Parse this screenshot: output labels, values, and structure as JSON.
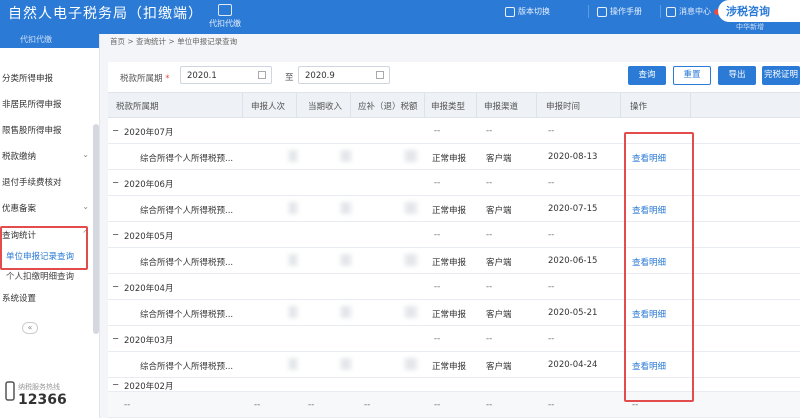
{
  "header": {
    "title": "自然人电子税务局（扣缴端）",
    "center_label": "代扣代缴",
    "links": [
      "版本切换",
      "操作手册",
      "消息中心"
    ],
    "user": "涉税咨询",
    "user_sub": "中华新增"
  },
  "sidebar": {
    "top_label": "代扣代缴",
    "items": [
      {
        "label": "分类所得申报",
        "chevron": ""
      },
      {
        "label": "非居民所得申报",
        "chevron": ""
      },
      {
        "label": "限售股所得申报",
        "chevron": ""
      },
      {
        "label": "税款缴纳",
        "chevron": "⌄"
      },
      {
        "label": "退付手续费核对",
        "chevron": ""
      },
      {
        "label": "优惠备案",
        "chevron": "⌄"
      },
      {
        "label": "查询统计",
        "chevron": "^"
      }
    ],
    "subitems": [
      "单位申报记录查询",
      "个人扣缴明细查询"
    ],
    "settings": "系统设置",
    "collapse_icon": "«",
    "hotline_label": "纳税服务热线",
    "hotline_number": "12366"
  },
  "breadcrumb": "首页 > 查询统计 > 单位申报记录查询",
  "filter": {
    "label": "税款所属期",
    "required_mark": "*",
    "from_value": "2020.1",
    "to_label": "至",
    "to_value": "2020.9"
  },
  "buttons": {
    "query": "查询",
    "reset": "重置",
    "export": "导出",
    "tax_proof": "完税证明"
  },
  "table": {
    "headers": [
      "税款所属期",
      "申报人次",
      "当期收入",
      "应补（退）税额",
      "申报类型",
      "申报渠道",
      "申报时间",
      "操作"
    ],
    "groups": [
      {
        "period": "2020年07月",
        "dash": "--",
        "detail": {
          "name": "综合所得个人所得税预...",
          "type": "正常申报",
          "channel": "客户端",
          "time": "2020-08-13",
          "action": "查看明细"
        }
      },
      {
        "period": "2020年06月",
        "dash": "--",
        "detail": {
          "name": "综合所得个人所得税预...",
          "type": "正常申报",
          "channel": "客户端",
          "time": "2020-07-15",
          "action": "查看明细"
        }
      },
      {
        "period": "2020年05月",
        "dash": "--",
        "detail": {
          "name": "综合所得个人所得税预...",
          "type": "正常申报",
          "channel": "客户端",
          "time": "2020-06-15",
          "action": "查看明细"
        }
      },
      {
        "period": "2020年04月",
        "dash": "--",
        "detail": {
          "name": "综合所得个人所得税预...",
          "type": "正常申报",
          "channel": "客户端",
          "time": "2020-05-21",
          "action": "查看明细"
        }
      },
      {
        "period": "2020年03月",
        "dash": "--",
        "detail": {
          "name": "综合所得个人所得税预...",
          "type": "正常申报",
          "channel": "客户端",
          "time": "2020-04-24",
          "action": "查看明细"
        }
      }
    ],
    "partial_period": "2020年02月",
    "footer_dash": "--"
  }
}
